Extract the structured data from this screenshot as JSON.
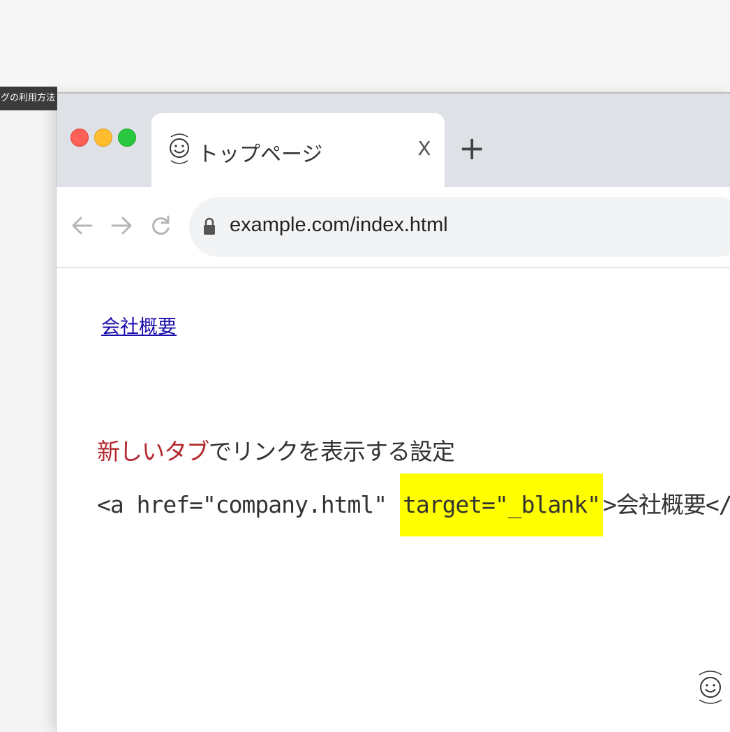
{
  "overlay": {
    "chapter_label": "タグの利用方法"
  },
  "browser": {
    "tab": {
      "title": "トップページ",
      "close_glyph": "X",
      "favicon": "smiley-archive-icon"
    },
    "new_tab_glyph": "+",
    "address_bar": {
      "url": "example.com/index.html"
    }
  },
  "page": {
    "link_text": "会社概要",
    "caption": {
      "accent": "新しいタブ",
      "rest": "でリンクを表示する設定"
    },
    "code": {
      "before": "<a href=\"company.html\" ",
      "highlight": "target=\"_blank\"",
      "after_tag": ">",
      "after_text": "会社概要",
      "closing": "</a>"
    }
  },
  "colors": {
    "link": "#1a0dab",
    "accent": "#b3272d",
    "highlight": "#ffff00",
    "tabbar": "#dee1e6"
  }
}
